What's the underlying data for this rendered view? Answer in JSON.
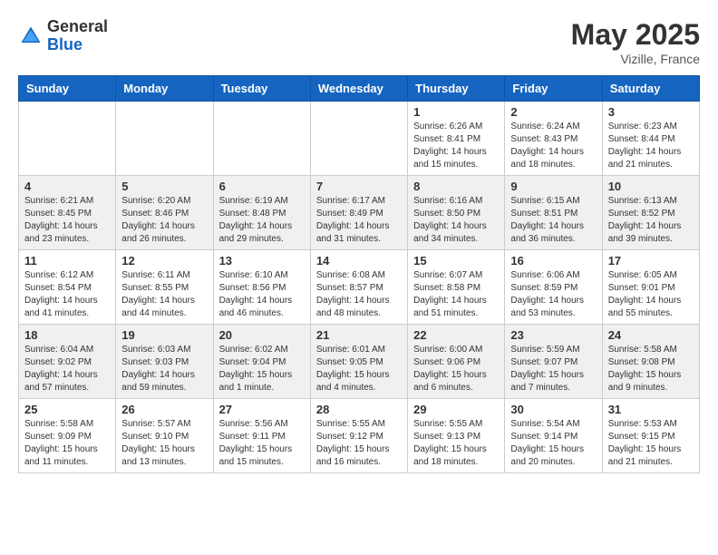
{
  "header": {
    "logo_general": "General",
    "logo_blue": "Blue",
    "month_year": "May 2025",
    "location": "Vizille, France"
  },
  "weekdays": [
    "Sunday",
    "Monday",
    "Tuesday",
    "Wednesday",
    "Thursday",
    "Friday",
    "Saturday"
  ],
  "weeks": [
    [
      {
        "day": "",
        "info": ""
      },
      {
        "day": "",
        "info": ""
      },
      {
        "day": "",
        "info": ""
      },
      {
        "day": "",
        "info": ""
      },
      {
        "day": "1",
        "info": "Sunrise: 6:26 AM\nSunset: 8:41 PM\nDaylight: 14 hours\nand 15 minutes."
      },
      {
        "day": "2",
        "info": "Sunrise: 6:24 AM\nSunset: 8:43 PM\nDaylight: 14 hours\nand 18 minutes."
      },
      {
        "day": "3",
        "info": "Sunrise: 6:23 AM\nSunset: 8:44 PM\nDaylight: 14 hours\nand 21 minutes."
      }
    ],
    [
      {
        "day": "4",
        "info": "Sunrise: 6:21 AM\nSunset: 8:45 PM\nDaylight: 14 hours\nand 23 minutes."
      },
      {
        "day": "5",
        "info": "Sunrise: 6:20 AM\nSunset: 8:46 PM\nDaylight: 14 hours\nand 26 minutes."
      },
      {
        "day": "6",
        "info": "Sunrise: 6:19 AM\nSunset: 8:48 PM\nDaylight: 14 hours\nand 29 minutes."
      },
      {
        "day": "7",
        "info": "Sunrise: 6:17 AM\nSunset: 8:49 PM\nDaylight: 14 hours\nand 31 minutes."
      },
      {
        "day": "8",
        "info": "Sunrise: 6:16 AM\nSunset: 8:50 PM\nDaylight: 14 hours\nand 34 minutes."
      },
      {
        "day": "9",
        "info": "Sunrise: 6:15 AM\nSunset: 8:51 PM\nDaylight: 14 hours\nand 36 minutes."
      },
      {
        "day": "10",
        "info": "Sunrise: 6:13 AM\nSunset: 8:52 PM\nDaylight: 14 hours\nand 39 minutes."
      }
    ],
    [
      {
        "day": "11",
        "info": "Sunrise: 6:12 AM\nSunset: 8:54 PM\nDaylight: 14 hours\nand 41 minutes."
      },
      {
        "day": "12",
        "info": "Sunrise: 6:11 AM\nSunset: 8:55 PM\nDaylight: 14 hours\nand 44 minutes."
      },
      {
        "day": "13",
        "info": "Sunrise: 6:10 AM\nSunset: 8:56 PM\nDaylight: 14 hours\nand 46 minutes."
      },
      {
        "day": "14",
        "info": "Sunrise: 6:08 AM\nSunset: 8:57 PM\nDaylight: 14 hours\nand 48 minutes."
      },
      {
        "day": "15",
        "info": "Sunrise: 6:07 AM\nSunset: 8:58 PM\nDaylight: 14 hours\nand 51 minutes."
      },
      {
        "day": "16",
        "info": "Sunrise: 6:06 AM\nSunset: 8:59 PM\nDaylight: 14 hours\nand 53 minutes."
      },
      {
        "day": "17",
        "info": "Sunrise: 6:05 AM\nSunset: 9:01 PM\nDaylight: 14 hours\nand 55 minutes."
      }
    ],
    [
      {
        "day": "18",
        "info": "Sunrise: 6:04 AM\nSunset: 9:02 PM\nDaylight: 14 hours\nand 57 minutes."
      },
      {
        "day": "19",
        "info": "Sunrise: 6:03 AM\nSunset: 9:03 PM\nDaylight: 14 hours\nand 59 minutes."
      },
      {
        "day": "20",
        "info": "Sunrise: 6:02 AM\nSunset: 9:04 PM\nDaylight: 15 hours\nand 1 minute."
      },
      {
        "day": "21",
        "info": "Sunrise: 6:01 AM\nSunset: 9:05 PM\nDaylight: 15 hours\nand 4 minutes."
      },
      {
        "day": "22",
        "info": "Sunrise: 6:00 AM\nSunset: 9:06 PM\nDaylight: 15 hours\nand 6 minutes."
      },
      {
        "day": "23",
        "info": "Sunrise: 5:59 AM\nSunset: 9:07 PM\nDaylight: 15 hours\nand 7 minutes."
      },
      {
        "day": "24",
        "info": "Sunrise: 5:58 AM\nSunset: 9:08 PM\nDaylight: 15 hours\nand 9 minutes."
      }
    ],
    [
      {
        "day": "25",
        "info": "Sunrise: 5:58 AM\nSunset: 9:09 PM\nDaylight: 15 hours\nand 11 minutes."
      },
      {
        "day": "26",
        "info": "Sunrise: 5:57 AM\nSunset: 9:10 PM\nDaylight: 15 hours\nand 13 minutes."
      },
      {
        "day": "27",
        "info": "Sunrise: 5:56 AM\nSunset: 9:11 PM\nDaylight: 15 hours\nand 15 minutes."
      },
      {
        "day": "28",
        "info": "Sunrise: 5:55 AM\nSunset: 9:12 PM\nDaylight: 15 hours\nand 16 minutes."
      },
      {
        "day": "29",
        "info": "Sunrise: 5:55 AM\nSunset: 9:13 PM\nDaylight: 15 hours\nand 18 minutes."
      },
      {
        "day": "30",
        "info": "Sunrise: 5:54 AM\nSunset: 9:14 PM\nDaylight: 15 hours\nand 20 minutes."
      },
      {
        "day": "31",
        "info": "Sunrise: 5:53 AM\nSunset: 9:15 PM\nDaylight: 15 hours\nand 21 minutes."
      }
    ]
  ]
}
